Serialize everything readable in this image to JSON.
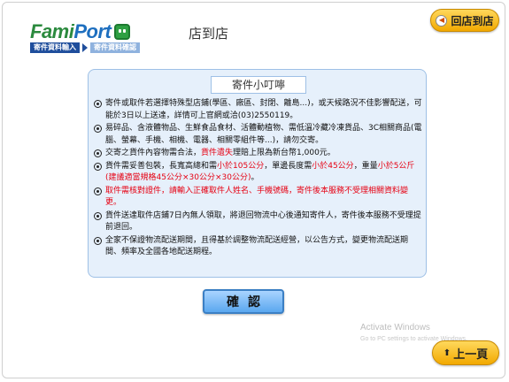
{
  "header": {
    "logo_text_a": "Fami",
    "logo_text_b": "Port",
    "page_title": "店到店",
    "breadcrumb": [
      "寄件資料輸入",
      "寄件資料確認"
    ]
  },
  "buttons": {
    "back_to_store": "回店到店",
    "confirm": "確認",
    "previous_page": "上一頁"
  },
  "notice": {
    "title": "寄件小叮嚀",
    "items": [
      {
        "text": "寄件或取件若選擇特殊型店鋪(學區、廠區、封閉、離島...)，或天候路況不佳影響配送，可能於3日以上送達，詳情可上官網或洽(03)2550119。"
      },
      {
        "text": "易碎品、含液體物品、生鮮食品食材、活體動植物、需低溫冷藏冷凍貨品、3C相關商品(電腦、螢幕、手機、相機、電器、相關零組件等...)，請勿交寄。"
      },
      {
        "pre": "交寄之貨件內容物需合法，",
        "red": "貨件遺失",
        "post": "理賠上限為新台幣1,000元。"
      },
      {
        "pre": "貨件需妥善包裝，長寬高總和需",
        "red": "小於105公分",
        "mid": "，單邊長度需",
        "red2": "小於45公分",
        "post": "，重量",
        "red3": "小於5公斤(建議適當規格45公分×30公分×30公分)",
        "post2": "。"
      },
      {
        "red": "取件需核對證件，請輸入正確取件人姓名、手機號碼，寄件後本服務不受理相關資料變更。"
      },
      {
        "text": "貨件送達取件店鋪7日內無人領取，將退回物流中心後通知寄件人，寄件後本服務不受理提前退回。"
      },
      {
        "text": "全家不保證物流配送期間，且得基於調整物流配送經營，以公告方式，變更物流配送期間、頻率及全國各地配送期程。"
      }
    ]
  },
  "watermark": {
    "title": "Activate Windows",
    "subtitle": "Go to PC settings to activate Windows."
  },
  "colors": {
    "panel_bg": "#e6f0fb",
    "accent_yellow": "#f2a900",
    "warning_red": "#e60012",
    "brand_green": "#2b8a3e"
  }
}
